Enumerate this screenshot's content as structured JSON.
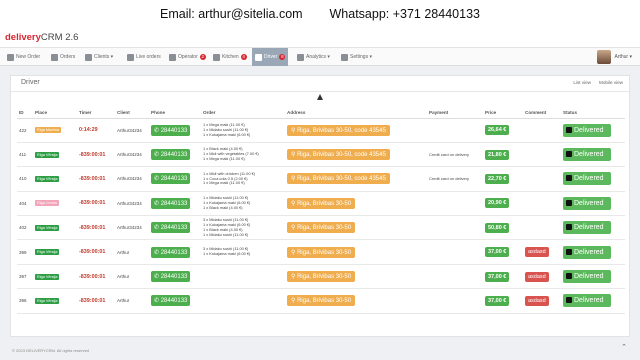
{
  "banner": {
    "email": "Email: arthur@sitelia.com",
    "whatsapp": "Whatsapp: +371 28440133"
  },
  "brand": {
    "name": "delivery",
    "suffix": "CRM 2.6"
  },
  "nav": [
    {
      "label": "New Order",
      "icon": "plus-icon",
      "badge": ""
    },
    {
      "label": "Orders",
      "icon": "list-icon",
      "badge": ""
    },
    {
      "label": "Clients ▾",
      "icon": "users-icon",
      "badge": ""
    },
    {
      "label": "Live orders",
      "icon": "play-icon",
      "badge": ""
    },
    {
      "label": "Operator",
      "icon": "headset-icon",
      "badge": "2"
    },
    {
      "label": "Kitchen",
      "icon": "kitchen-icon",
      "badge": "4"
    },
    {
      "label": "Driver",
      "icon": "car-icon",
      "badge": "8"
    },
    {
      "label": "Analytics ▾",
      "icon": "chart-icon",
      "badge": ""
    },
    {
      "label": "Settings ▾",
      "icon": "gear-icon",
      "badge": ""
    }
  ],
  "user": {
    "name": "Arthur ▾"
  },
  "panel": {
    "title": "Driver",
    "list_view": "List view",
    "mobile_view": "Mobile view"
  },
  "columns": [
    "ID",
    "Place",
    "Timer",
    "Client",
    "Phone",
    "Order",
    "Address",
    "Payment",
    "Price",
    "Comment",
    "Status"
  ],
  "rows": [
    {
      "id": "422",
      "place": "Riga Maxima",
      "place_color": "#f0ad4e",
      "timer": "0:14:29",
      "client": "Arthur34234",
      "phone": "28440133",
      "order": [
        "1 x Mega maki (11.00 €)",
        "1 x Midaku sushi (11.00 €)",
        "1 x Kukajama maki (6.00 €)"
      ],
      "address": "Riga, Brivibas 30-50, code 43545",
      "address_color": "#f0ad4e",
      "payment": "",
      "price": "26,64 €",
      "comment": "",
      "status": "Delivered"
    },
    {
      "id": "411",
      "place": "Riga Vērsija",
      "place_color": "#2e9e44",
      "timer": "-839:00:01",
      "client": "Arthur34234",
      "phone": "28440133",
      "order": [
        "1 x Black maki (4.00 €)",
        "1 x Midi with vegetables (7.00 €)",
        "1 x Mega maki (11.00 €)"
      ],
      "address": "Riga, Brivibas 30-50, code 43545",
      "address_color": "#f0ad4e",
      "payment": "Credit card on delivery",
      "price": "21,80 €",
      "comment": "",
      "status": "Delivered"
    },
    {
      "id": "410",
      "place": "Riga Vērsija",
      "place_color": "#2e9e44",
      "timer": "-839:00:01",
      "client": "Arthur34234",
      "phone": "28440133",
      "order": [
        "1 x Midi with chicken (11.00 €)",
        "1 x Coca cola 0.5 (2.00 €)",
        "1 x Mega maki (11.00 €)"
      ],
      "address": "Riga, Brivibas 30-50, code 43545",
      "address_color": "#f0ad4e",
      "payment": "Credit card on delivery",
      "price": "22,70 €",
      "comment": "",
      "status": "Delivered"
    },
    {
      "id": "404",
      "place": "Riga Centrs",
      "place_color": "#f2a4b8",
      "timer": "-839:00:01",
      "client": "Arthur34234",
      "phone": "28440133",
      "order": [
        "1 x Midaku sushi (11.00 €)",
        "1 x Kukajama maki (6.00 €)",
        "1 x Black maki (4.00 €)"
      ],
      "address": "Riga, Brivibas 30-50",
      "address_color": "#f0ad4e",
      "payment": "",
      "price": "20,90 €",
      "comment": "",
      "status": "Delivered"
    },
    {
      "id": "402",
      "place": "Riga Vērsija",
      "place_color": "#2e9e44",
      "timer": "-839:00:01",
      "client": "Arthur34234",
      "phone": "28440133",
      "order": [
        "3 x Midaku sushi (11.00 €)",
        "1 x Kukajama maki (6.00 €)",
        "1 x Black maki (4.00 €)",
        "1 x Midaku sushi (11.00 €)"
      ],
      "address": "Riga, Brivibas 30-50",
      "address_color": "#f0ad4e",
      "payment": "",
      "price": "50,80 €",
      "comment": "",
      "status": "Delivered"
    },
    {
      "id": "399",
      "place": "Riga Vērsija",
      "place_color": "#2e9e44",
      "timer": "-839:00:01",
      "client": "Arthur",
      "phone": "28440133",
      "order": [
        "3 x Midaku sushi (11.00 €)",
        "1 x Kukajama maki (6.00 €)"
      ],
      "address": "Riga, Brivibas 30-50",
      "address_color": "#f0ad4e",
      "payment": "",
      "price": "37,00 €",
      "comment": "asdasd",
      "status": "Delivered"
    },
    {
      "id": "397",
      "place": "Riga Vērsija",
      "place_color": "#2e9e44",
      "timer": "-839:00:01",
      "client": "Arthur",
      "phone": "28440133",
      "order": [],
      "address": "Riga, Brivibas 30-50",
      "address_color": "#f0ad4e",
      "payment": "",
      "price": "37,00 €",
      "comment": "asdasd",
      "status": "Delivered"
    },
    {
      "id": "396",
      "place": "Riga Vērsija",
      "place_color": "#2e9e44",
      "timer": "-839:00:01",
      "client": "Arthur",
      "phone": "28440133",
      "order": [],
      "address": "Riga, Brivibas 30-50",
      "address_color": "#f0ad4e",
      "payment": "",
      "price": "37,00 €",
      "comment": "asdasd",
      "status": "Delivered"
    }
  ],
  "footer": {
    "text": "© 2023 DELIVERYCRM. All rights reserved"
  }
}
